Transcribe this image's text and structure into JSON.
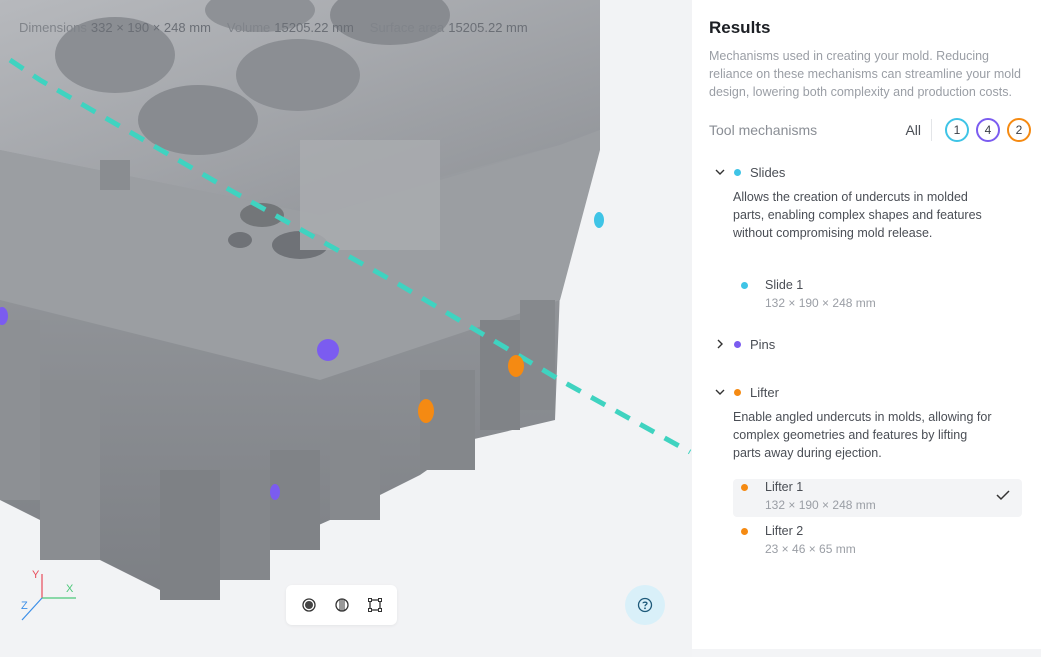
{
  "viewport": {
    "stats": [
      {
        "label": "Dimensions",
        "value": "332 × 190 × 248 mm"
      },
      {
        "label": "Volume",
        "value": "15205.22 mm"
      },
      {
        "label": "Surface area",
        "value": "15205.22 mm"
      }
    ],
    "axes": {
      "x": "X",
      "y": "Y",
      "z": "Z"
    },
    "toolbar": [
      "shaded-view-icon",
      "wireframe-view-icon",
      "bounding-box-icon"
    ],
    "help_icon": "help-icon"
  },
  "panel": {
    "title": "Results",
    "description": "Mechanisms used in creating your mold. Reducing reliance on these mechanisms can streamline your mold design, lowering both complexity and production costs.",
    "tool_label": "Tool mechanisms",
    "filter_all": "All",
    "filters": [
      {
        "count": "1",
        "color": "#3fc4e6"
      },
      {
        "count": "4",
        "color": "#7b5cf0"
      },
      {
        "count": "2",
        "color": "#f58a12"
      }
    ],
    "groups": {
      "slides": {
        "name": "Slides",
        "color": "#3fc4e6",
        "description": "Allows the creation of undercuts in molded parts, enabling complex shapes and features without compromising mold release.",
        "items": [
          {
            "name": "Slide 1",
            "dims": "132 × 190 × 248 mm"
          }
        ]
      },
      "pins": {
        "name": "Pins",
        "color": "#7b5cf0"
      },
      "lifter": {
        "name": "Lifter",
        "color": "#f58a12",
        "description": "Enable angled undercuts in molds, allowing for complex geometries and features by lifting parts away during ejection.",
        "items": [
          {
            "name": "Lifter 1",
            "dims": "132 × 190 × 248 mm",
            "selected": true
          },
          {
            "name": "Lifter 2",
            "dims": "23 × 46 × 65 mm"
          }
        ]
      }
    }
  }
}
